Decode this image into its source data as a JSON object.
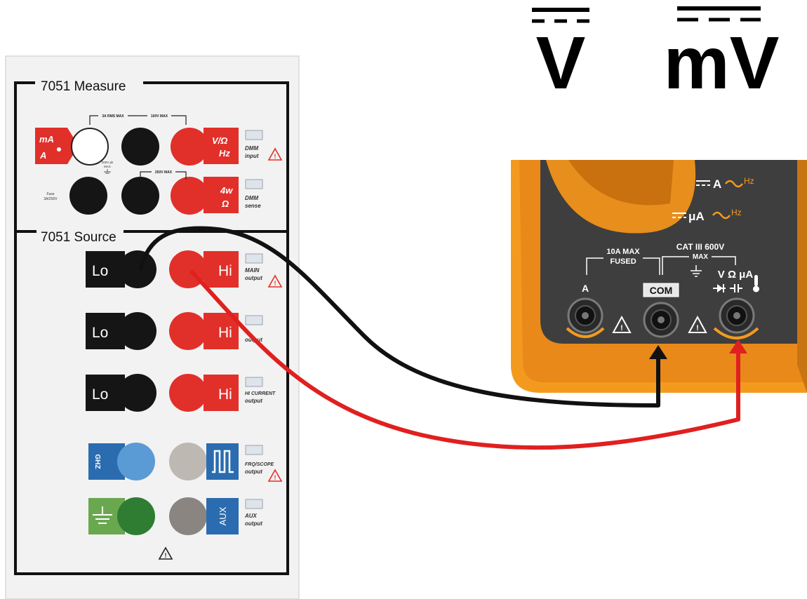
{
  "symbols": {
    "volts_dc": "V",
    "millivolts_dc": "mV"
  },
  "calibrator": {
    "measure_title": "7051 Measure",
    "source_title": "7051 Source",
    "measure": {
      "ma_label_top": "mA",
      "ma_label_bottom": "A",
      "range_left": "3A RMS MAX",
      "range_right": "100V MAX",
      "vohm_top": "V/Ω",
      "vohm_bottom": "Hz",
      "dmm_input_1": "DMM",
      "dmm_input_2": "input",
      "fuse_1": "Fuse",
      "fuse_2": "3A/250V",
      "small_note_1": "200V pk",
      "small_note_2": "MAX",
      "sense_range": "250V MAX",
      "w4_top": "4w",
      "w4_bottom": "Ω",
      "dmm_sense_1": "DMM",
      "dmm_sense_2": "sense"
    },
    "source": {
      "lo": "Lo",
      "hi": "Hi",
      "main_1": "MAIN",
      "main_2": "output",
      "row2_2": "output",
      "hicur_1": "HI CURRENT",
      "hicur_2": "output",
      "ghz": "GHZ",
      "frq_1": "FRQ/SCOPE",
      "frq_2": "output",
      "aux": "AUX",
      "aux_1": "AUX",
      "aux_2": "output"
    }
  },
  "meter": {
    "dc_a_hz": "A",
    "hz1": "Hz",
    "dc_ua_hz": "μA",
    "hz2": "Hz",
    "max_10a": "10A MAX",
    "fused": "FUSED",
    "cat": "CAT III 600V",
    "max": "MAX",
    "jack_a": "A",
    "jack_com": "COM",
    "jack_v": "V Ω μA"
  },
  "colors": {
    "red": "#e0201f",
    "black": "#111111",
    "orange": "#f39a1e",
    "meter_gray": "#454545"
  }
}
